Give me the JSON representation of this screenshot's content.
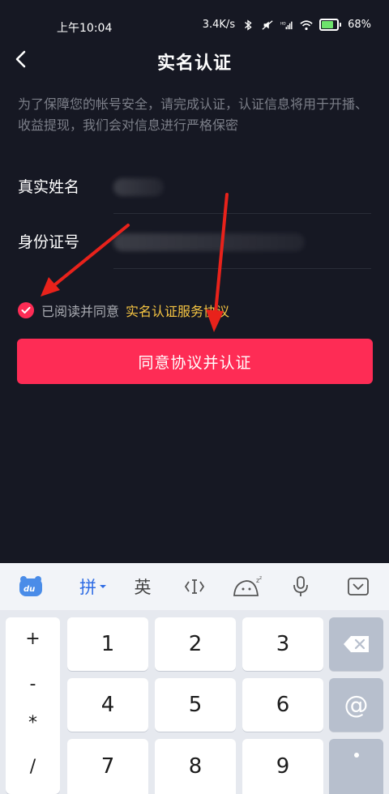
{
  "status_bar": {
    "time": "上午10:04",
    "speed": "3.4K/s",
    "battery_percent": "68%",
    "battery_level": 0.68,
    "icons": [
      "bluetooth-icon",
      "mute-icon",
      "hd-signal-icon",
      "wifi-icon",
      "battery-icon"
    ]
  },
  "header": {
    "title": "实名认证",
    "back_icon": "chevron-left-icon"
  },
  "notice": "为了保障您的帐号安全，请完成认证，认证信息将用于开播、收益提现，我们会对信息进行严格保密",
  "form": {
    "name_label": "真实姓名",
    "id_label": "身份证号"
  },
  "agreement": {
    "checked": true,
    "prefix": "已阅读并同意",
    "link": "实名认证服务协议"
  },
  "submit_label": "同意协议并认证",
  "keyboard": {
    "toolbar": {
      "pinyin": "拼",
      "english": "英"
    },
    "symbols": [
      "+",
      "-",
      "*",
      "/"
    ],
    "keys": [
      "1",
      "2",
      "3",
      "4",
      "5",
      "6",
      "7",
      "8",
      "9"
    ],
    "at_key": "@"
  },
  "colors": {
    "background": "#161823",
    "accent": "#fe2c55",
    "link": "#f5c442",
    "annotation_arrow": "#e8221b"
  }
}
